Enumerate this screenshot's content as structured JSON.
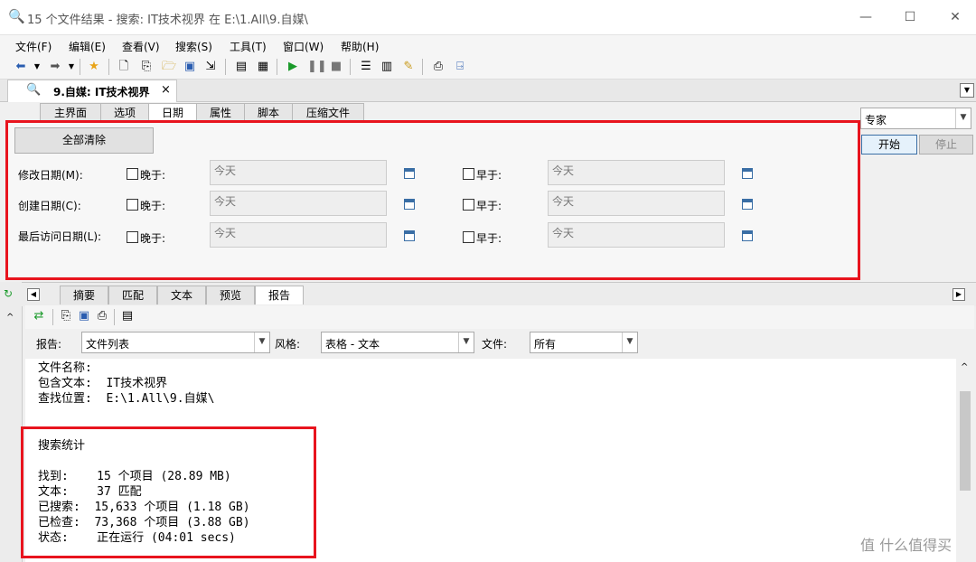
{
  "window": {
    "title": "15 个文件结果 - 搜索: IT技术视界 在 E:\\1.All\\9.自媒\\",
    "minimize": "—",
    "maximize": "☐",
    "close": "✕"
  },
  "menu": [
    "文件(F)",
    "编辑(E)",
    "查看(V)",
    "搜索(S)",
    "工具(T)",
    "窗口(W)",
    "帮助(H)"
  ],
  "doc_tab": {
    "label": "9.自媒: IT技术视界",
    "close": "×"
  },
  "criteria_tabs": [
    "主界面",
    "选项",
    "日期",
    "属性",
    "脚本",
    "压缩文件"
  ],
  "date_panel": {
    "clear_all": "全部清除",
    "rows": [
      {
        "label": "修改日期(M):",
        "after": "晚于:",
        "after_value": "今天",
        "before": "早于:",
        "before_value": "今天"
      },
      {
        "label": "创建日期(C):",
        "after": "晚于:",
        "after_value": "今天",
        "before": "早于:",
        "before_value": "今天"
      },
      {
        "label": "最后访问日期(L):",
        "after": "晚于:",
        "after_value": "今天",
        "before": "早于:",
        "before_value": "今天"
      }
    ]
  },
  "right_panel": {
    "mode": "专家",
    "start": "开始",
    "stop": "停止"
  },
  "result_tabs": [
    "摘要",
    "匹配",
    "文本",
    "预览",
    "报告"
  ],
  "report_options": {
    "report_label": "报告:",
    "report_value": "文件列表",
    "style_label": "风格:",
    "style_value": "表格 - 文本",
    "files_label": "文件:",
    "files_value": "所有"
  },
  "report_lines": [
    "文件名称:",
    "包含文本:  IT技术视界",
    "查找位置:  E:\\1.All\\9.自媒\\"
  ],
  "stats": {
    "title": "搜索统计",
    "lines": [
      "找到:    15 个项目 (28.89 MB)",
      "文本:    37 匹配",
      "已搜索:  15,633 个项目 (1.18 GB)",
      "已检查:  73,368 个项目 (3.88 GB)",
      "状态:    正在运行 (04:01 secs)"
    ]
  },
  "watermark": "值 什么值得买",
  "colors": {
    "highlight": "#e8141e",
    "accent_blue": "#3a6ea5",
    "play_green": "#1a9a2a"
  }
}
